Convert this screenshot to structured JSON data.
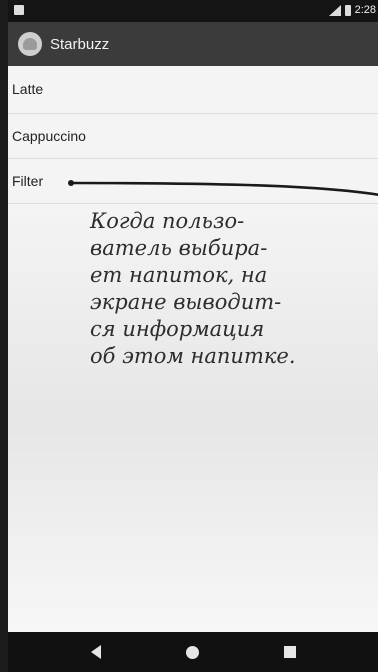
{
  "statusbar": {
    "time": "2:28"
  },
  "appbar": {
    "title": "Starbuzz"
  },
  "list": {
    "items": [
      {
        "label": "Latte"
      },
      {
        "label": "Cappuccino"
      },
      {
        "label": "Filter"
      }
    ]
  },
  "annotation": {
    "text": "Когда пользо-\nватель выбира-\nет напиток, на\nэкране выводит-\nся информация\nоб этом напитке."
  },
  "navbar": {
    "icons": [
      "back-icon",
      "home-icon",
      "recents-icon"
    ]
  },
  "colors": {
    "appbar": "#3b3b3b",
    "statusbar": "#141414",
    "navbar": "#111111",
    "background": "#f4f4f4"
  }
}
